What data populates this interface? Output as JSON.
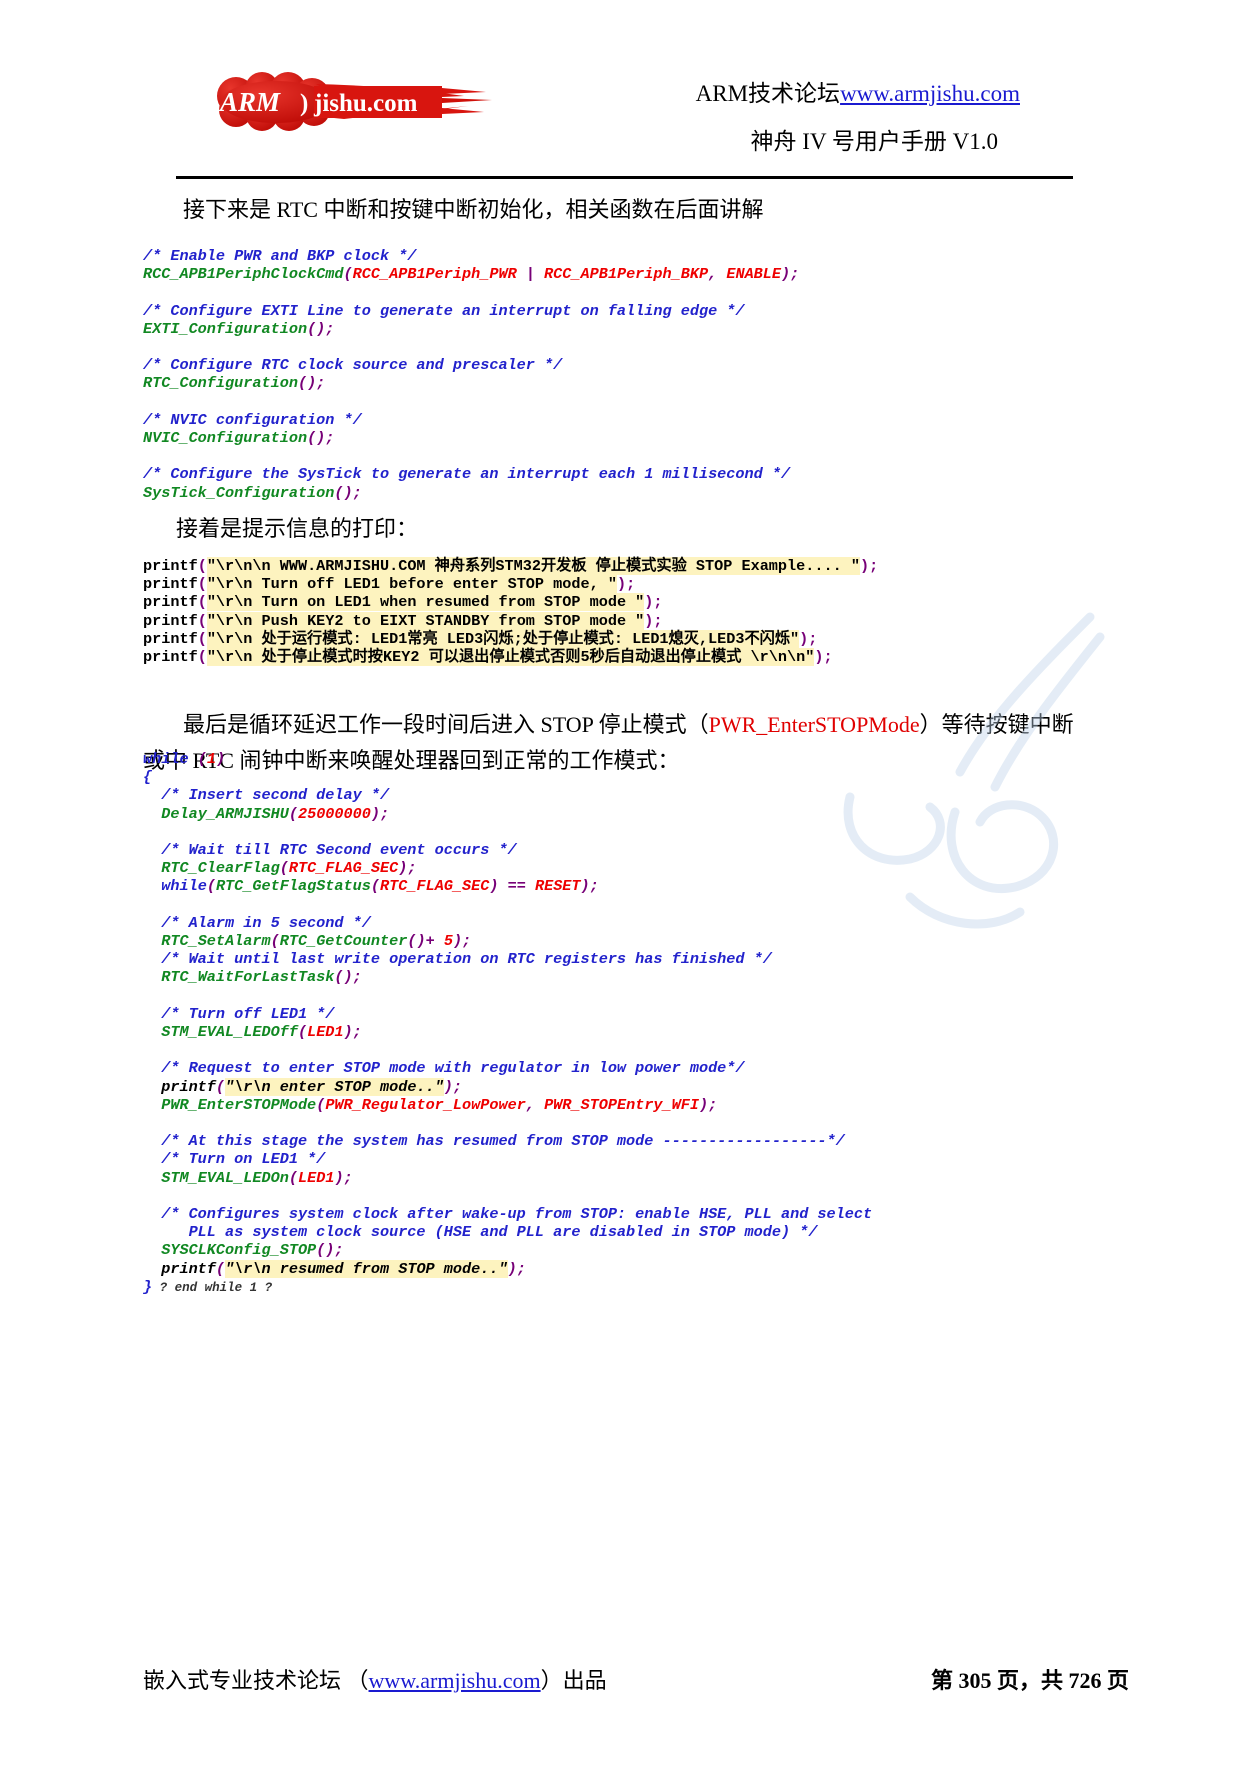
{
  "header": {
    "logo_text": "ARMjishu.com",
    "logo_color": "#d8150f",
    "line1_prefix": "ARM技术论坛",
    "line1_link": "www.armjishu.com",
    "line2": "神舟 IV 号用户手册 V1.0"
  },
  "body": {
    "para1": "接下来是 RTC 中断和按键中断初始化，相关函数在后面讲解",
    "para2": "接着是提示信息的打印：",
    "para3_a": "最后是循环延迟工作一段时间后进入 STOP 停止模式（",
    "para3_red": "PWR_EnterSTOPMode",
    "para3_b": "）等待按键中断或中 RTC 闹钟中断来唤醒处理器回到正常的工作模式："
  },
  "code_block_1": {
    "lines": [
      {
        "segments": [
          {
            "t": "/* Enable PWR and BKP clock */",
            "c": "cm"
          }
        ]
      },
      {
        "segments": [
          {
            "t": "RCC_APB1PeriphClockCmd",
            "c": "fn"
          },
          {
            "t": "(",
            "c": "pu"
          },
          {
            "t": "RCC_APB1Periph_PWR",
            "c": "ar"
          },
          {
            "t": " | ",
            "c": "pu"
          },
          {
            "t": "RCC_APB1Periph_BKP",
            "c": "ar"
          },
          {
            "t": ", ",
            "c": "pu"
          },
          {
            "t": "ENABLE",
            "c": "ar"
          },
          {
            "t": ");",
            "c": "pu"
          }
        ]
      },
      {
        "segments": [
          {
            "t": "",
            "c": "st"
          }
        ]
      },
      {
        "segments": [
          {
            "t": "/* Configure EXTI Line to generate an interrupt on falling edge */",
            "c": "cm"
          }
        ]
      },
      {
        "segments": [
          {
            "t": "EXTI_Configuration",
            "c": "fn"
          },
          {
            "t": "();",
            "c": "pu"
          }
        ]
      },
      {
        "segments": [
          {
            "t": "",
            "c": "st"
          }
        ]
      },
      {
        "segments": [
          {
            "t": "/* Configure RTC clock source and prescaler */",
            "c": "cm"
          }
        ]
      },
      {
        "segments": [
          {
            "t": "RTC_Configuration",
            "c": "fn"
          },
          {
            "t": "();",
            "c": "pu"
          }
        ]
      },
      {
        "segments": [
          {
            "t": "",
            "c": "st"
          }
        ]
      },
      {
        "segments": [
          {
            "t": "/* NVIC configuration */",
            "c": "cm"
          }
        ]
      },
      {
        "segments": [
          {
            "t": "NVIC_Configuration",
            "c": "fn"
          },
          {
            "t": "();",
            "c": "pu"
          }
        ]
      },
      {
        "segments": [
          {
            "t": "",
            "c": "st"
          }
        ]
      },
      {
        "segments": [
          {
            "t": "/* Configure the SysTick to generate an interrupt each 1 millisecond */",
            "c": "cm"
          }
        ]
      },
      {
        "segments": [
          {
            "t": "SysTick_Configuration",
            "c": "fn"
          },
          {
            "t": "();",
            "c": "pu"
          }
        ]
      }
    ]
  },
  "code_block_2": {
    "lines": [
      {
        "segments": [
          {
            "t": "printf",
            "c": "st"
          },
          {
            "t": "(",
            "c": "pu"
          },
          {
            "t": "\"\\r\\n\\n WWW.ARMJISHU.COM 神舟系列STM32开发板 停止模式实验 STOP Example.... \"",
            "c": "hl"
          },
          {
            "t": ");",
            "c": "pu"
          }
        ]
      },
      {
        "segments": [
          {
            "t": "printf",
            "c": "st"
          },
          {
            "t": "(",
            "c": "pu"
          },
          {
            "t": "\"\\r\\n Turn off LED1 before enter STOP mode, \"",
            "c": "hl"
          },
          {
            "t": ");",
            "c": "pu"
          }
        ]
      },
      {
        "segments": [
          {
            "t": "printf",
            "c": "st"
          },
          {
            "t": "(",
            "c": "pu"
          },
          {
            "t": "\"\\r\\n Turn on LED1 when resumed from STOP mode \"",
            "c": "hl"
          },
          {
            "t": ");",
            "c": "pu"
          }
        ]
      },
      {
        "segments": [
          {
            "t": "printf",
            "c": "st"
          },
          {
            "t": "(",
            "c": "pu"
          },
          {
            "t": "\"\\r\\n Push KEY2 to EIXT STANDBY from STOP mode \"",
            "c": "hl"
          },
          {
            "t": ");",
            "c": "pu"
          }
        ]
      },
      {
        "segments": [
          {
            "t": "printf",
            "c": "st"
          },
          {
            "t": "(",
            "c": "pu"
          },
          {
            "t": "\"\\r\\n 处于运行模式: LED1常亮 LED3闪烁;处于停止模式: LED1熄灭,LED3不闪烁\"",
            "c": "hl"
          },
          {
            "t": ");",
            "c": "pu"
          }
        ]
      },
      {
        "segments": [
          {
            "t": "printf",
            "c": "st"
          },
          {
            "t": "(",
            "c": "pu"
          },
          {
            "t": "\"\\r\\n 处于停止模式时按KEY2 可以退出停止模式否则5秒后自动退出停止模式 \\r\\n\\n\"",
            "c": "hl"
          },
          {
            "t": ");",
            "c": "pu"
          }
        ]
      }
    ]
  },
  "code_block_3": {
    "lines": [
      {
        "segments": [
          {
            "t": "while ",
            "c": "kw"
          },
          {
            "t": "(",
            "c": "pu"
          },
          {
            "t": "1",
            "c": "ar"
          },
          {
            "t": ")",
            "c": "pu"
          }
        ]
      },
      {
        "segments": [
          {
            "t": "{",
            "c": "brc"
          }
        ]
      },
      {
        "segments": [
          {
            "t": "  /* Insert second delay */",
            "c": "cm"
          }
        ]
      },
      {
        "segments": [
          {
            "t": "  ",
            "c": "st"
          },
          {
            "t": "Delay_ARMJISHU",
            "c": "fn"
          },
          {
            "t": "(",
            "c": "pu"
          },
          {
            "t": "25000000",
            "c": "ar"
          },
          {
            "t": ");",
            "c": "pu"
          }
        ]
      },
      {
        "segments": [
          {
            "t": "",
            "c": "st"
          }
        ]
      },
      {
        "segments": [
          {
            "t": "  /* Wait till RTC Second event occurs */",
            "c": "cm"
          }
        ]
      },
      {
        "segments": [
          {
            "t": "  ",
            "c": "st"
          },
          {
            "t": "RTC_ClearFlag",
            "c": "fn"
          },
          {
            "t": "(",
            "c": "pu"
          },
          {
            "t": "RTC_FLAG_SEC",
            "c": "ar"
          },
          {
            "t": ");",
            "c": "pu"
          }
        ]
      },
      {
        "segments": [
          {
            "t": "  ",
            "c": "st"
          },
          {
            "t": "while",
            "c": "kw"
          },
          {
            "t": "(",
            "c": "pu"
          },
          {
            "t": "RTC_GetFlagStatus",
            "c": "fn"
          },
          {
            "t": "(",
            "c": "pu"
          },
          {
            "t": "RTC_FLAG_SEC",
            "c": "ar"
          },
          {
            "t": ") == ",
            "c": "pu"
          },
          {
            "t": "RESET",
            "c": "ar"
          },
          {
            "t": ");",
            "c": "pu"
          }
        ]
      },
      {
        "segments": [
          {
            "t": "",
            "c": "st"
          }
        ]
      },
      {
        "segments": [
          {
            "t": "  /* Alarm in 5 second */",
            "c": "cm"
          }
        ]
      },
      {
        "segments": [
          {
            "t": "  ",
            "c": "st"
          },
          {
            "t": "RTC_SetAlarm",
            "c": "fn"
          },
          {
            "t": "(",
            "c": "pu"
          },
          {
            "t": "RTC_GetCounter",
            "c": "fn"
          },
          {
            "t": "()",
            "c": "pu"
          },
          {
            "t": "+ ",
            "c": "pu"
          },
          {
            "t": "5",
            "c": "ar"
          },
          {
            "t": ");",
            "c": "pu"
          }
        ]
      },
      {
        "segments": [
          {
            "t": "  /* Wait until last write operation on RTC registers has finished */",
            "c": "cm"
          }
        ]
      },
      {
        "segments": [
          {
            "t": "  ",
            "c": "st"
          },
          {
            "t": "RTC_WaitForLastTask",
            "c": "fn"
          },
          {
            "t": "();",
            "c": "pu"
          }
        ]
      },
      {
        "segments": [
          {
            "t": "",
            "c": "st"
          }
        ]
      },
      {
        "segments": [
          {
            "t": "  /* Turn off LED1 */",
            "c": "cm"
          }
        ]
      },
      {
        "segments": [
          {
            "t": "  ",
            "c": "st"
          },
          {
            "t": "STM_EVAL_LEDOff",
            "c": "fn"
          },
          {
            "t": "(",
            "c": "pu"
          },
          {
            "t": "LED1",
            "c": "ar"
          },
          {
            "t": ");",
            "c": "pu"
          }
        ]
      },
      {
        "segments": [
          {
            "t": "",
            "c": "st"
          }
        ]
      },
      {
        "segments": [
          {
            "t": "  /* Request to enter STOP mode with regulator in low power mode*/",
            "c": "cm"
          }
        ]
      },
      {
        "segments": [
          {
            "t": "  printf",
            "c": "st"
          },
          {
            "t": "(",
            "c": "pu"
          },
          {
            "t": "\"\\r\\n enter STOP mode..\"",
            "c": "hl"
          },
          {
            "t": ");",
            "c": "pu"
          }
        ]
      },
      {
        "segments": [
          {
            "t": "  ",
            "c": "st"
          },
          {
            "t": "PWR_EnterSTOPMode",
            "c": "fn"
          },
          {
            "t": "(",
            "c": "pu"
          },
          {
            "t": "PWR_Regulator_LowPower",
            "c": "ar"
          },
          {
            "t": ", ",
            "c": "pu"
          },
          {
            "t": "PWR_STOPEntry_WFI",
            "c": "ar"
          },
          {
            "t": ");",
            "c": "pu"
          }
        ]
      },
      {
        "segments": [
          {
            "t": "",
            "c": "st"
          }
        ]
      },
      {
        "segments": [
          {
            "t": "  /* At this stage the system has resumed from STOP mode ------------------*/",
            "c": "cm"
          }
        ]
      },
      {
        "segments": [
          {
            "t": "  /* Turn on LED1 */",
            "c": "cm"
          }
        ]
      },
      {
        "segments": [
          {
            "t": "  ",
            "c": "st"
          },
          {
            "t": "STM_EVAL_LEDOn",
            "c": "fn"
          },
          {
            "t": "(",
            "c": "pu"
          },
          {
            "t": "LED1",
            "c": "ar"
          },
          {
            "t": ");",
            "c": "pu"
          }
        ]
      },
      {
        "segments": [
          {
            "t": "",
            "c": "st"
          }
        ]
      },
      {
        "segments": [
          {
            "t": "  /* Configures system clock after wake-up from STOP: enable HSE, PLL and select",
            "c": "cm"
          }
        ]
      },
      {
        "segments": [
          {
            "t": "     PLL as system clock source (HSE and PLL are disabled in STOP mode) */",
            "c": "cm"
          }
        ]
      },
      {
        "segments": [
          {
            "t": "  ",
            "c": "st"
          },
          {
            "t": "SYSCLKConfig_STOP",
            "c": "fn"
          },
          {
            "t": "();",
            "c": "pu"
          }
        ]
      },
      {
        "segments": [
          {
            "t": "  printf",
            "c": "st"
          },
          {
            "t": "(",
            "c": "pu"
          },
          {
            "t": "\"\\r\\n resumed from STOP mode..\"",
            "c": "hl"
          },
          {
            "t": ");",
            "c": "pu"
          }
        ]
      },
      {
        "segments": [
          {
            "t": "}",
            "c": "brc"
          },
          {
            "t": " ? end while 1 ?",
            "c": "endnote"
          }
        ]
      }
    ]
  },
  "footer": {
    "left_prefix": "嵌入式专业技术论坛 （",
    "left_link": "www.armjishu.com",
    "left_suffix": "）出品",
    "right": "第 305 页，共 726 页"
  }
}
